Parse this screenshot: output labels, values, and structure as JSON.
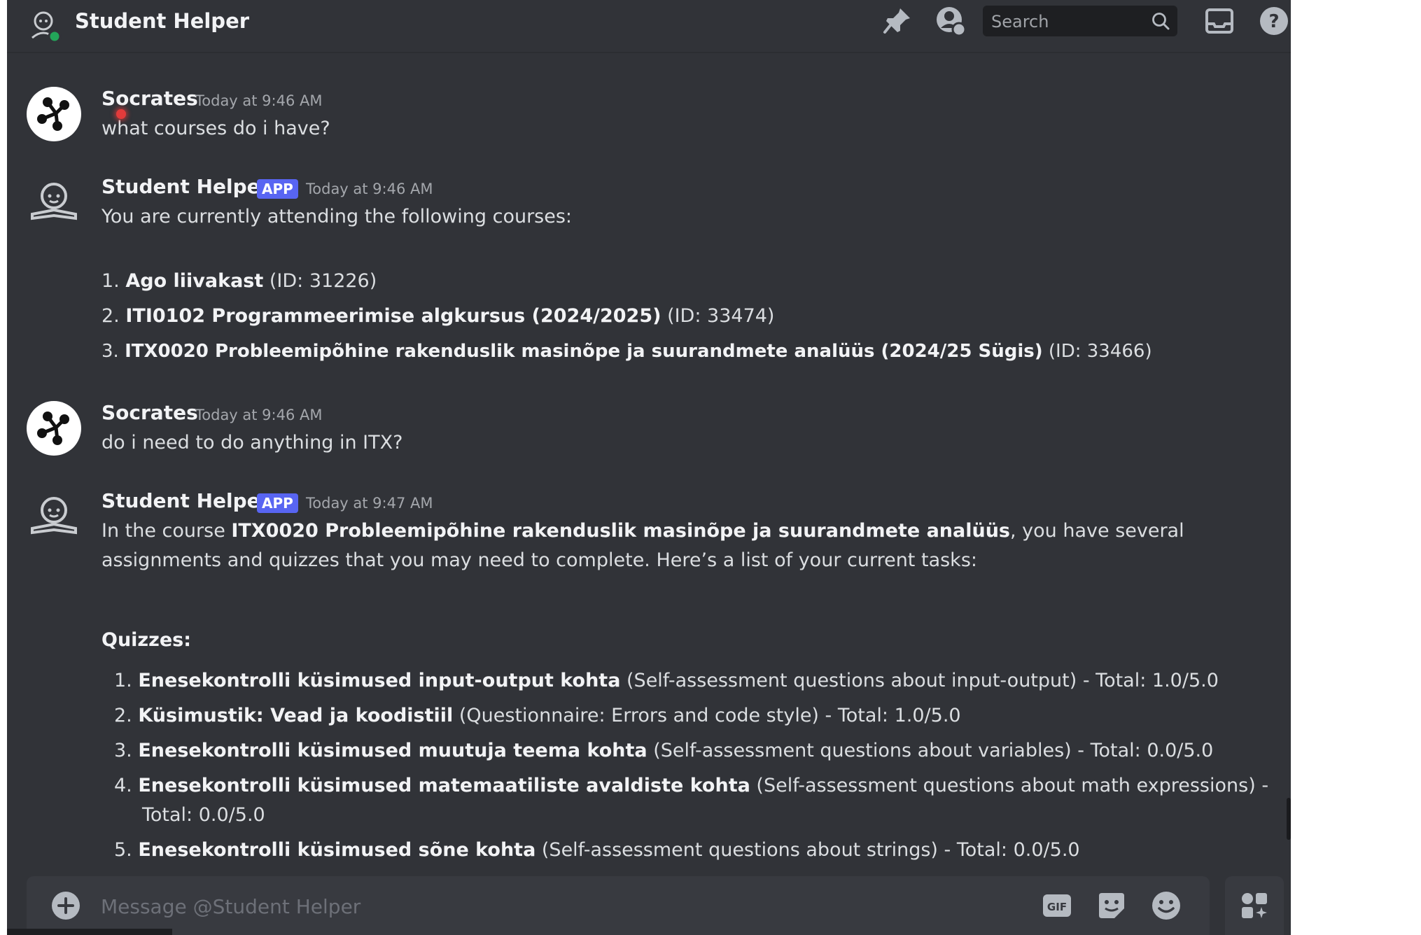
{
  "header": {
    "title": "Student Helper",
    "search_placeholder": "Search"
  },
  "messages": [
    {
      "author": "Socrates",
      "timestamp": "Today at 9:46 AM",
      "text": "what courses do i have?"
    },
    {
      "author": "Student Helper",
      "badge": "APP",
      "timestamp": "Today at 9:46 AM",
      "intro": "You are currently attending the following courses:",
      "courses": [
        {
          "num": "1.",
          "name": "Ago liivakast",
          "id": "(ID: 31226)"
        },
        {
          "num": "2.",
          "name": "ITI0102 Programmeerimise algkursus (2024/2025)",
          "id": "(ID: 33474)"
        },
        {
          "num": "3.",
          "name": "ITX0020 Probleemipõhine rakenduslik masinõpe ja suurandmete analüüs (2024/25 Sügis)",
          "id": "(ID: 33466)"
        }
      ]
    },
    {
      "author": "Socrates",
      "timestamp": "Today at 9:46 AM",
      "text": "do i need to do anything in ITX?"
    },
    {
      "author": "Student Helper",
      "badge": "APP",
      "timestamp": "Today at 9:47 AM",
      "intro_prefix": "In the course ",
      "intro_course": "ITX0020 Probleemipõhine rakenduslik masinõpe ja suurandmete analüüs",
      "intro_suffix": ", you have several assignments and quizzes that you may need to complete. Here’s a list of your current tasks:",
      "section_title": "Quizzes:",
      "quizzes": [
        {
          "num": "1.",
          "name": "Enesekontrolli küsimused input-output kohta",
          "desc": " (Self-assessment questions about input-output) - Total: 1.0/5.0"
        },
        {
          "num": "2.",
          "name": "Küsimustik: Vead ja koodistiil",
          "desc": " (Questionnaire: Errors and code style) - Total: 1.0/5.0"
        },
        {
          "num": "3.",
          "name": "Enesekontrolli küsimused muutuja teema kohta",
          "desc": " (Self-assessment questions about variables) - Total: 0.0/5.0"
        },
        {
          "num": "4.",
          "name": "Enesekontrolli küsimused matemaatiliste avaldiste kohta",
          "desc": " (Self-assessment questions about math expressions) -"
        },
        {
          "num": "",
          "name": "",
          "desc": "Total: 0.0/5.0"
        },
        {
          "num": "5.",
          "name": "Enesekontrolli küsimused sõne kohta",
          "desc": " (Self-assessment questions about strings) - Total: 0.0/5.0"
        }
      ]
    }
  ],
  "composer": {
    "placeholder": "Message @Student Helper"
  },
  "icons": {
    "pin": "pin-icon",
    "profile": "user-profile-icon",
    "search": "search-icon",
    "inbox": "inbox-icon",
    "help": "help-icon",
    "add": "add-attachment-icon",
    "gif": "gif-icon",
    "sticker": "sticker-icon",
    "emoji": "emoji-icon",
    "apps": "apps-icon"
  },
  "colors": {
    "background": "#313338",
    "header_border": "#2b2d31",
    "app_badge": "#5865f2",
    "composer": "#383a40"
  }
}
